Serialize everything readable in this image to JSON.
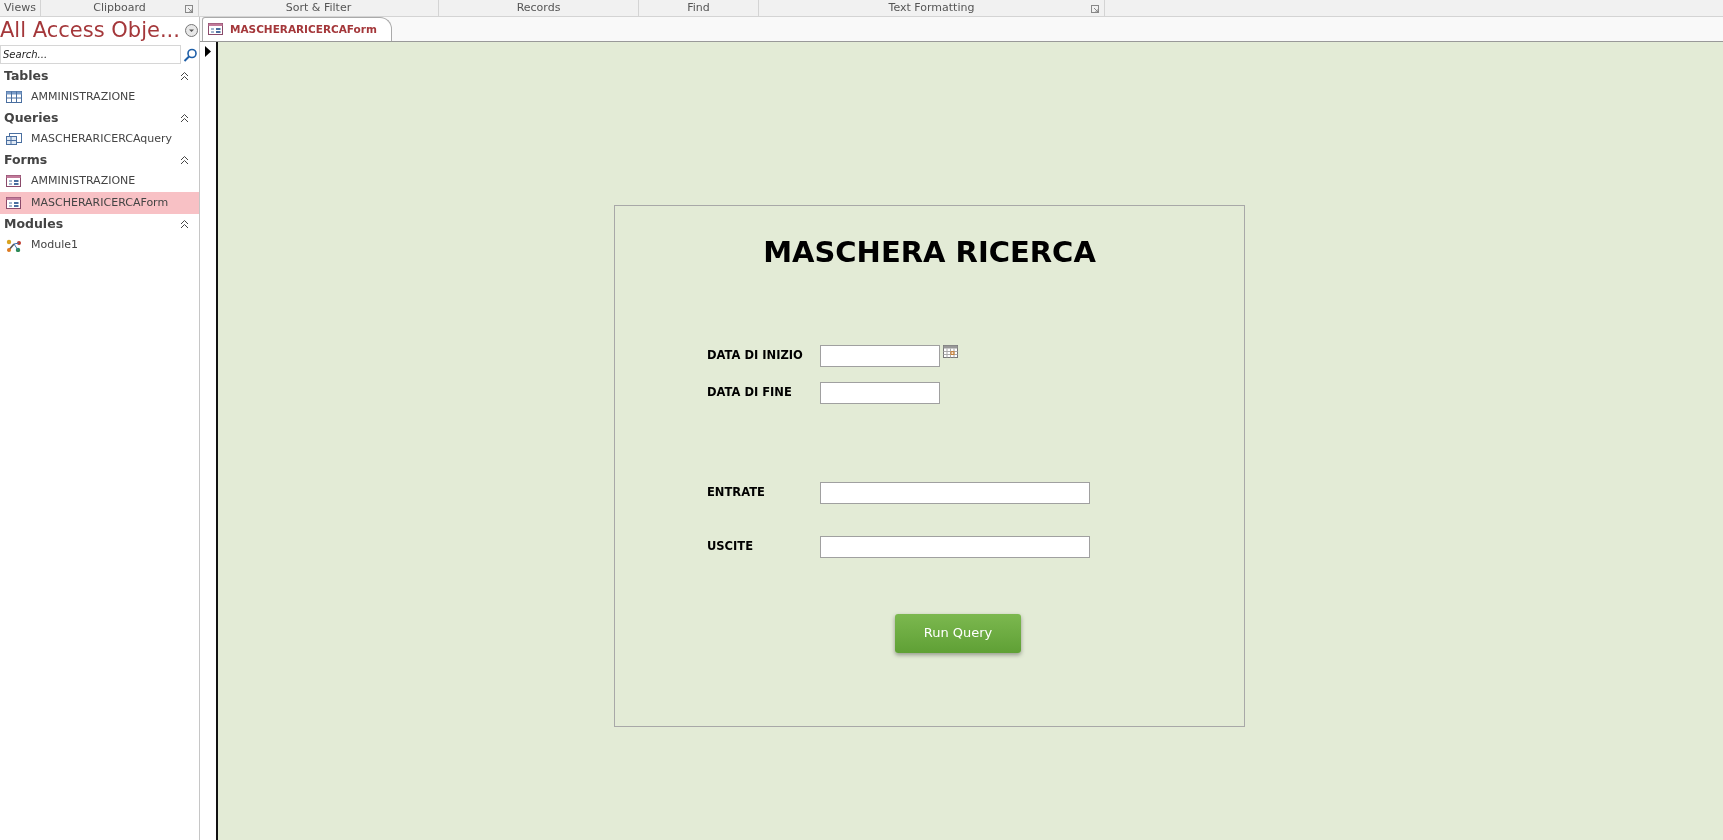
{
  "ribbon_groups": [
    {
      "label": "Views",
      "launcher": false
    },
    {
      "label": "Clipboard",
      "launcher": true
    },
    {
      "label": "Sort & Filter",
      "launcher": false
    },
    {
      "label": "Records",
      "launcher": false
    },
    {
      "label": "Find",
      "launcher": false
    },
    {
      "label": "Text Formatting",
      "launcher": true
    }
  ],
  "nav_pane": {
    "title": "All Access Obje...",
    "search": {
      "placeholder": "Search..."
    },
    "groups": [
      {
        "label": "Tables",
        "expanded": true,
        "items": [
          {
            "label": "AMMINISTRAZIONE",
            "kind": "table",
            "selected": false
          }
        ]
      },
      {
        "label": "Queries",
        "expanded": true,
        "items": [
          {
            "label": "MASCHERARICERCAquery",
            "kind": "query",
            "selected": false
          }
        ]
      },
      {
        "label": "Forms",
        "expanded": true,
        "items": [
          {
            "label": "AMMINISTRAZIONE",
            "kind": "form",
            "selected": false
          },
          {
            "label": "MASCHERARICERCAForm",
            "kind": "form",
            "selected": true
          }
        ]
      },
      {
        "label": "Modules",
        "expanded": true,
        "items": [
          {
            "label": "Module1",
            "kind": "module",
            "selected": false
          }
        ]
      }
    ]
  },
  "document_tabs": [
    {
      "label": "MASCHERARICERCAForm",
      "selected": true
    }
  ],
  "form": {
    "title": "MASCHERA RICERCA",
    "fields": [
      {
        "label": "DATA DI INIZIO",
        "kind": "date",
        "date_picker": true
      },
      {
        "label": "DATA DI FINE",
        "kind": "date",
        "date_picker": false
      },
      {
        "label": "ENTRATE",
        "kind": "amount",
        "date_picker": false
      },
      {
        "label": "USCITE",
        "kind": "amount",
        "date_picker": false
      }
    ],
    "button": {
      "label": "Run Query"
    }
  }
}
